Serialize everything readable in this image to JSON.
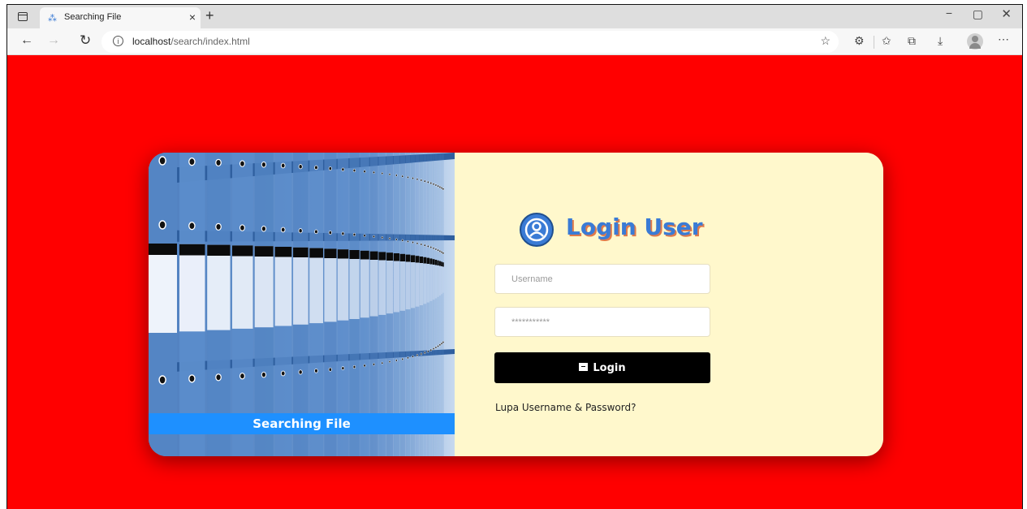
{
  "browser": {
    "tab_title": "Searching File",
    "tab_close": "×",
    "new_tab": "+",
    "url_host": "localhost",
    "url_path": "/search/index.html",
    "window_controls": {
      "minimize": "−",
      "maximize": "▢",
      "close": "✕"
    }
  },
  "hero": {
    "caption": "Searching File"
  },
  "login": {
    "title": "Login User",
    "username_placeholder": "Username",
    "password_placeholder": "***********",
    "button_label": "Login",
    "forgot_link": "Lupa Username & Password?"
  },
  "colors": {
    "page_background": "#ff0000",
    "panel_background": "#fff8cc",
    "title": "#3a7bd5",
    "caption_bar": "#1e90ff",
    "button": "#000000"
  },
  "icons": [
    "sidebar-toggle-icon",
    "tab-favicon-icon",
    "back-icon",
    "forward-icon",
    "reload-icon",
    "info-icon",
    "favorite-star-icon",
    "extensions-icon",
    "favorites-icon",
    "collections-icon",
    "downloads-icon",
    "profile-icon",
    "more-icon",
    "user-circle-icon",
    "archive-icon"
  ]
}
